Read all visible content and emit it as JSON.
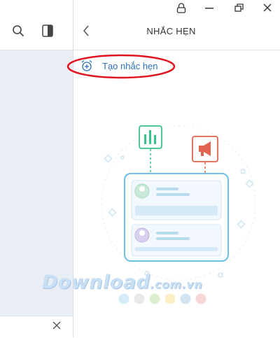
{
  "window": {
    "controls": [
      "lock-icon",
      "minimize-icon",
      "restore-icon",
      "close-icon"
    ]
  },
  "sidebar": {
    "icons": [
      "search-icon",
      "panel-icon",
      "close-icon"
    ]
  },
  "header": {
    "title": "NHẮC HẸN",
    "back_icon": "chevron-left-icon"
  },
  "reminder": {
    "create_label": "Tạo nhắc hẹn",
    "create_icon": "alarm-plus-icon",
    "highlight_color": "#e0141e"
  },
  "illustration": {
    "icons": [
      "bar-chart-icon",
      "megaphone-icon"
    ],
    "colors": {
      "green": "#39c28a",
      "red": "#e2634f",
      "blue": "#6fbfe7"
    }
  },
  "watermark": {
    "text": "Download",
    "suffix": ".com.vn",
    "dot_colors": [
      "#d6ecf8",
      "#e8e8e8",
      "#dcefd0",
      "#fbefc6",
      "#d2e3f2",
      "#f7d6d6"
    ]
  }
}
